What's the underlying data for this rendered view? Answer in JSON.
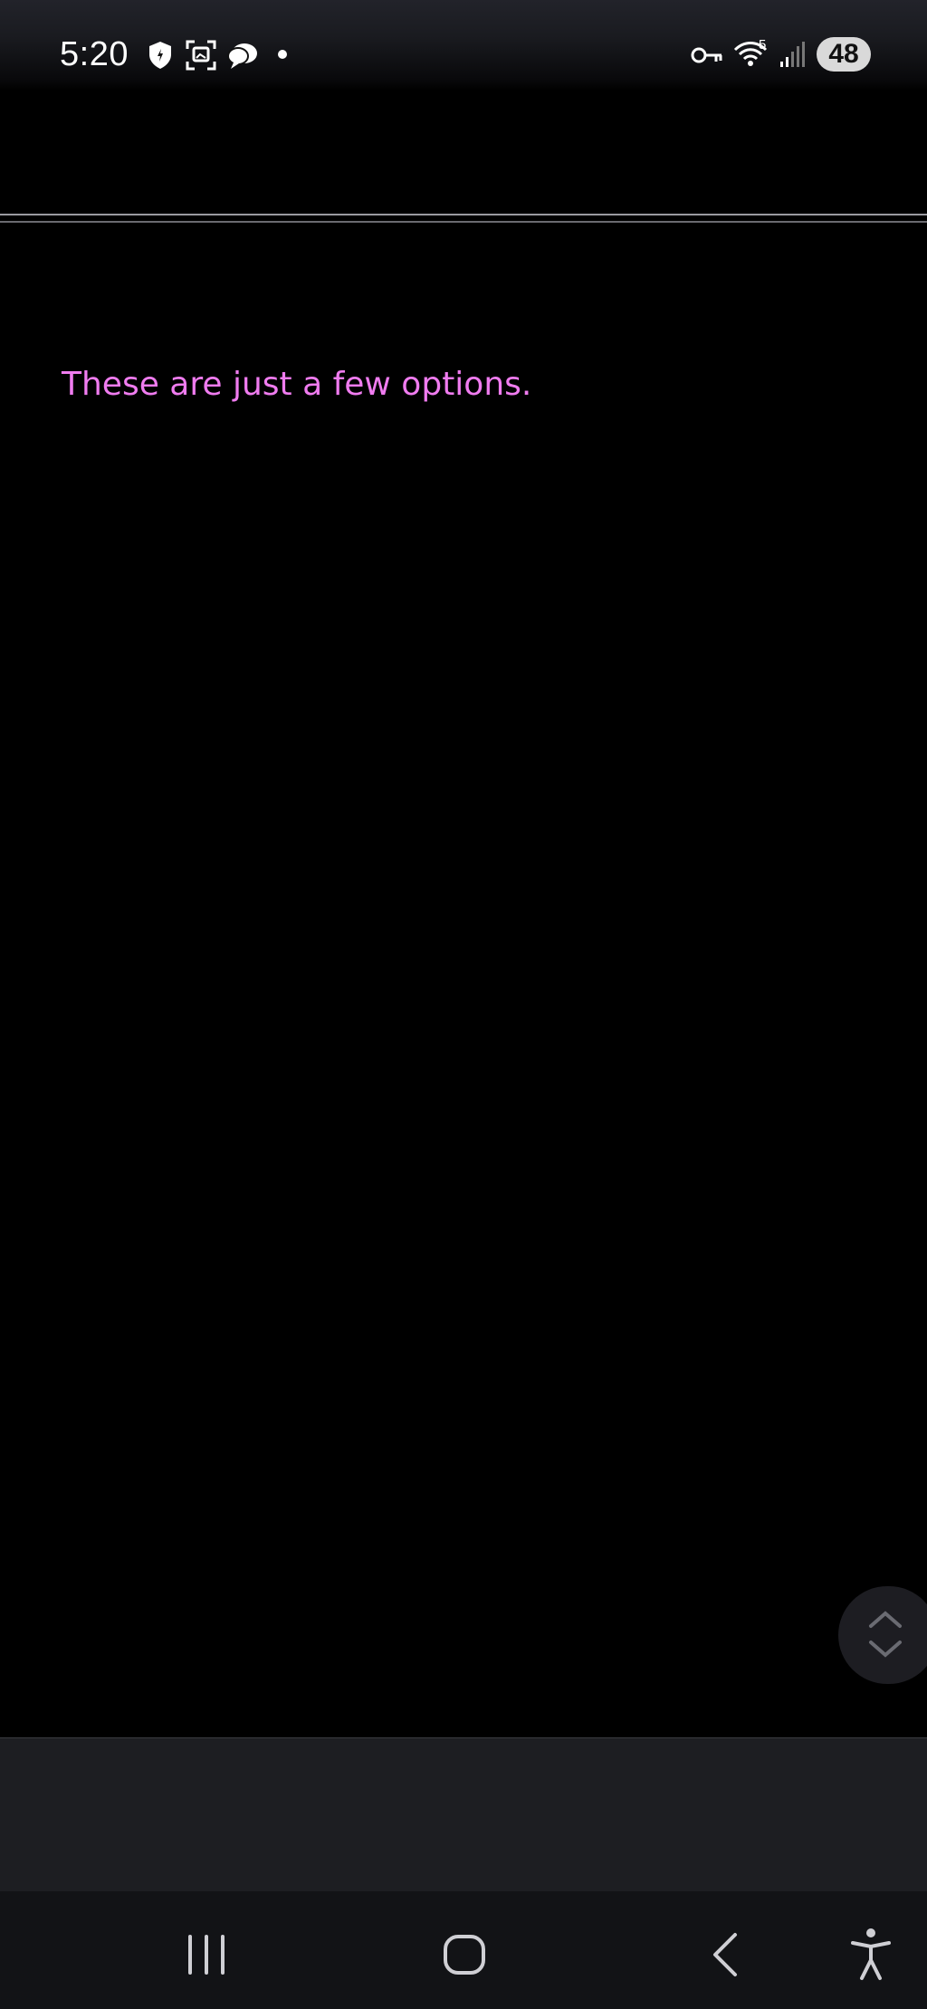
{
  "status_bar": {
    "time": "5:20",
    "battery": "48",
    "network_label": "5",
    "icons": [
      "shield-icon",
      "screenshot-icon",
      "chat-bubble-icon",
      "notification-dot-icon",
      "vpn-key-icon",
      "wifi-icon",
      "signal-icon"
    ]
  },
  "content": {
    "message": "These are just a few options.",
    "message_color": "#f07cf0"
  },
  "scroll_button": {
    "icon": "scroll-up-down-icon"
  },
  "nav_bar": {
    "buttons": [
      "recent-apps-icon",
      "home-icon",
      "back-icon",
      "accessibility-icon"
    ]
  }
}
